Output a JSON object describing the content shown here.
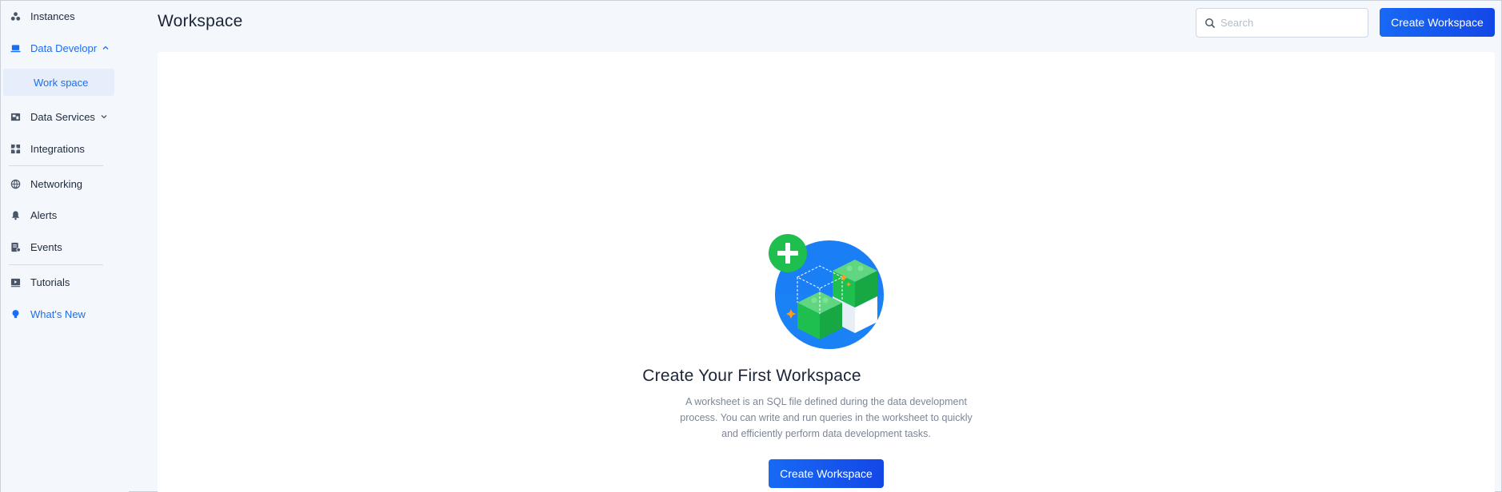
{
  "sidebar": {
    "items": [
      {
        "label": "Instances",
        "icon": "instances-icon"
      },
      {
        "label": "Data Developr",
        "icon": "laptop-icon"
      },
      {
        "label": "Work space"
      },
      {
        "label": "Data Services",
        "icon": "data-services-icon"
      },
      {
        "label": "Integrations",
        "icon": "integrations-icon"
      },
      {
        "label": "Networking",
        "icon": "globe-icon"
      },
      {
        "label": "Alerts",
        "icon": "bell-icon"
      },
      {
        "label": "Events",
        "icon": "events-icon"
      },
      {
        "label": "Tutorials",
        "icon": "video-icon"
      },
      {
        "label": "What's New",
        "icon": "lightbulb-icon"
      }
    ]
  },
  "header": {
    "title": "Workspace",
    "search_placeholder": "Search",
    "create_label": "Create Workspace"
  },
  "empty_state": {
    "title": "Create Your First Workspace",
    "description": "A worksheet is an SQL file defined during the data development process. You can write and run queries in the worksheet to quickly and efficiently perform data development tasks.",
    "button_label": "Create Workspace"
  },
  "colors": {
    "accent": "#1a6ef5",
    "sidebar_bg": "#f4f7fc",
    "illustration_green": "#1fbf4f",
    "illustration_blue": "#1a7ef5"
  }
}
